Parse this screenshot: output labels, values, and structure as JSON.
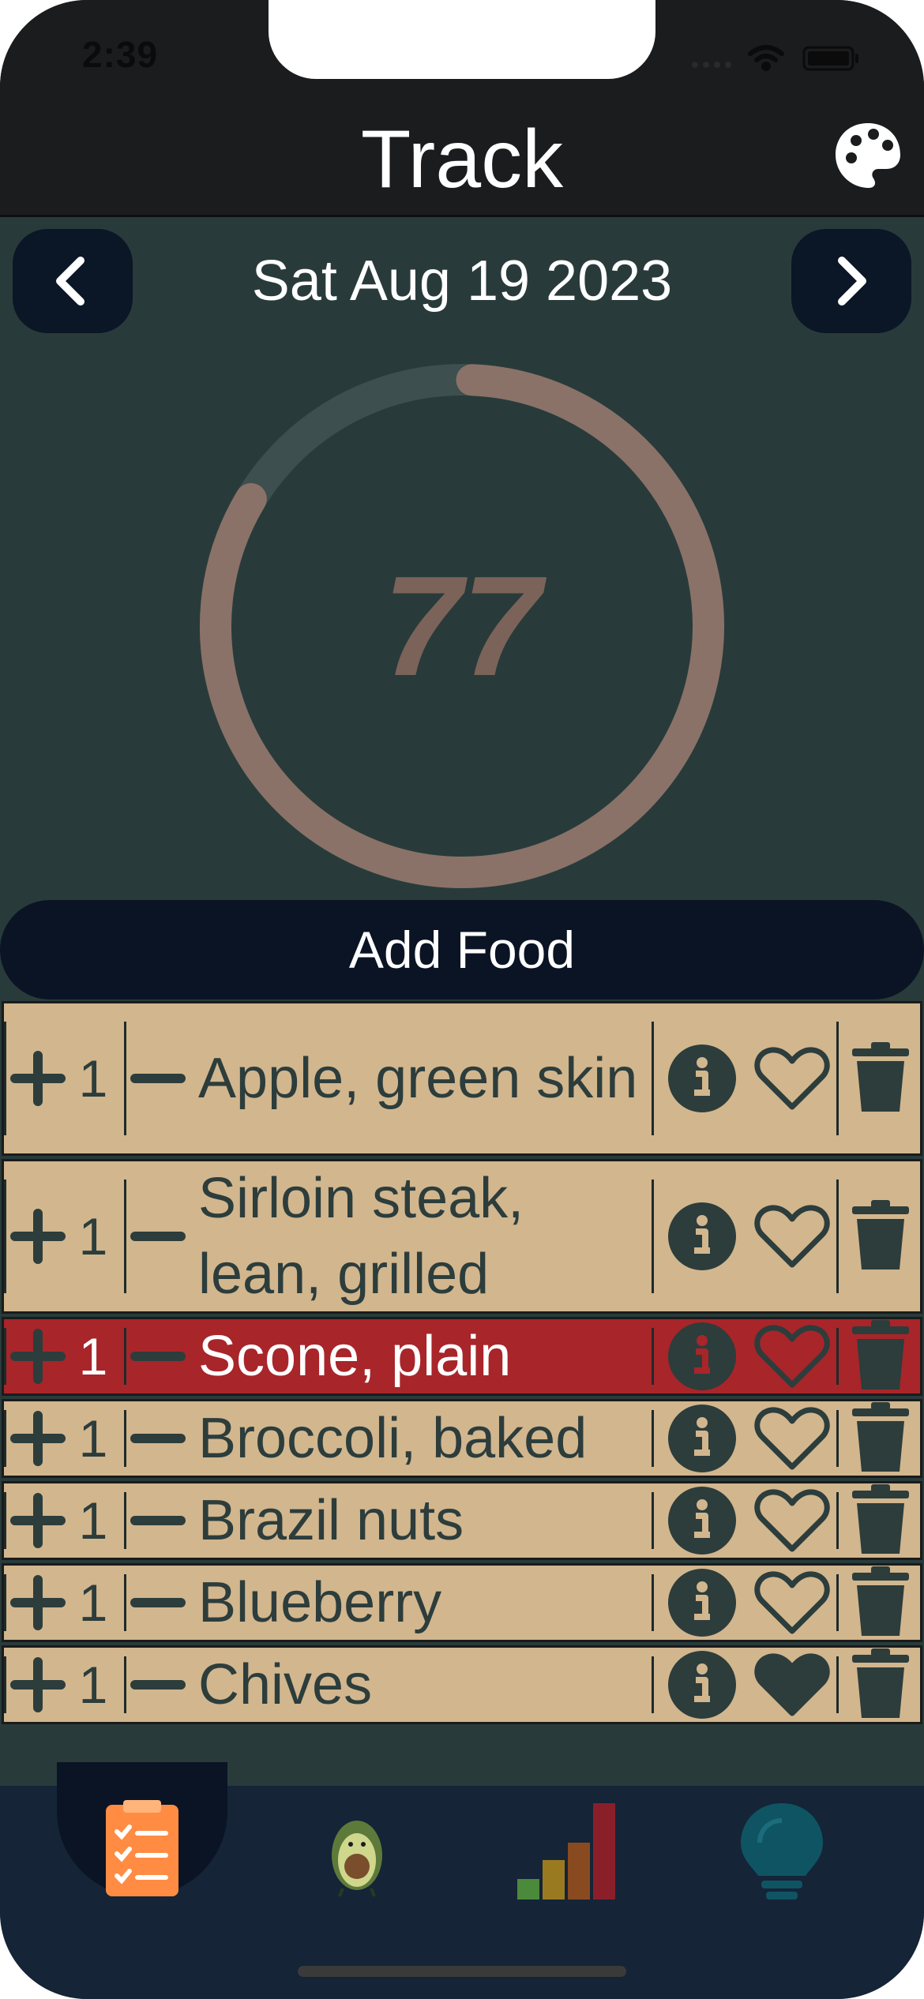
{
  "status": {
    "time": "2:39"
  },
  "header": {
    "title": "Track",
    "palette_icon": "palette-icon"
  },
  "date_nav": {
    "date": "Sat Aug 19 2023",
    "prev_icon": "chevron-left-icon",
    "next_icon": "chevron-right-icon"
  },
  "score": {
    "value": "77",
    "progress": 0.83,
    "ring_color": "#8a7268"
  },
  "add_food": {
    "label": "Add Food"
  },
  "foods": [
    {
      "name": "Apple, green skin",
      "qty": "1",
      "favorite": false,
      "highlight": false
    },
    {
      "name": "Sirloin steak, lean, grilled",
      "qty": "1",
      "favorite": false,
      "highlight": false
    },
    {
      "name": "Scone, plain",
      "qty": "1",
      "favorite": false,
      "highlight": true
    },
    {
      "name": "Broccoli, baked",
      "qty": "1",
      "favorite": false,
      "highlight": false
    },
    {
      "name": "Brazil nuts",
      "qty": "1",
      "favorite": false,
      "highlight": false
    },
    {
      "name": "Blueberry",
      "qty": "1",
      "favorite": false,
      "highlight": false
    },
    {
      "name": "Chives",
      "qty": "1",
      "favorite": true,
      "highlight": false
    }
  ],
  "tabs": [
    {
      "icon": "clipboard-checklist-icon",
      "active": true
    },
    {
      "icon": "avocado-icon",
      "active": false
    },
    {
      "icon": "bar-chart-icon",
      "active": false
    },
    {
      "icon": "lightbulb-icon",
      "active": false
    }
  ],
  "colors": {
    "row_bg": "#d2b68e",
    "row_highlight": "#a8252a",
    "accent": "#ff8c42"
  }
}
